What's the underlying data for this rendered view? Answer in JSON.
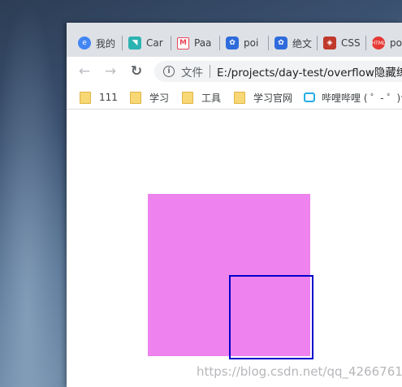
{
  "tabs": [
    {
      "label": "我的",
      "icon": "chrome-icon",
      "color": "#4285f4"
    },
    {
      "label": "Car",
      "icon": "teal-leaf-icon",
      "color": "#2bb3b1"
    },
    {
      "label": "Paa",
      "icon": "m-logo-icon",
      "color": "#e8455a"
    },
    {
      "label": "poi",
      "icon": "baidu-paw-icon",
      "color": "#2f6bdc"
    },
    {
      "label": "绝文",
      "icon": "baidu-paw-icon",
      "color": "#2f6bdc"
    },
    {
      "label": "CSS",
      "icon": "css-shield-icon",
      "color": "#c0392b"
    },
    {
      "label": "po",
      "icon": "html-circle-icon",
      "color": "#e53935"
    }
  ],
  "toolbar": {
    "back_icon": "←",
    "forward_icon": "→",
    "reload_icon": "↻",
    "scheme_label": "文件",
    "url": "E:/projects/day-test/overflow隐藏练习.html"
  },
  "bookmarks": [
    {
      "label": "111",
      "icon": "folder-icon"
    },
    {
      "label": "学习",
      "icon": "folder-icon"
    },
    {
      "label": "工具",
      "icon": "folder-icon"
    },
    {
      "label": "学习官网",
      "icon": "folder-icon"
    },
    {
      "label": "哔哩哔哩 ( ゜- ゜)つロ 干杯~-bilibili",
      "icon": "bilibili-icon"
    }
  ],
  "page": {
    "outer_box_color": "#ee82ee",
    "inner_box_border_color": "#0000cd"
  },
  "watermark": "https://blog.csdn.net/qq_42667613"
}
